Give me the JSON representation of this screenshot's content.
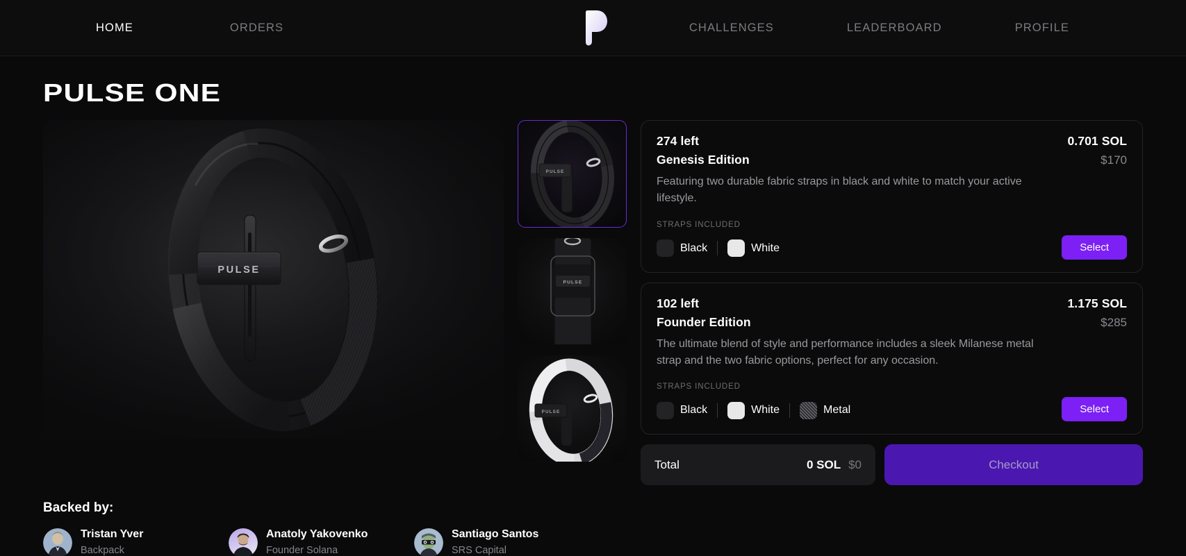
{
  "nav": {
    "left_items": [
      {
        "label": "HOME",
        "active": true
      },
      {
        "label": "ORDERS",
        "active": false
      }
    ],
    "right_items": [
      {
        "label": "CHALLENGES",
        "active": false
      },
      {
        "label": "LEADERBOARD",
        "active": false
      },
      {
        "label": "PROFILE",
        "active": false
      }
    ],
    "logo": {
      "icon": "pulse-p-logo",
      "color": "#ded9f7"
    }
  },
  "page": {
    "title_part1": "PULSE",
    "title_part2": "ONE",
    "title_full": "PULSE ONE"
  },
  "hero": {
    "alt": "Black PULSE fitness band angled view",
    "logo_text": "PULSE"
  },
  "thumbnails": [
    {
      "alt": "black band angled view",
      "logo_text": "PULSE",
      "selected": true,
      "name": "thumb-black-angled"
    },
    {
      "alt": "black band front view",
      "logo_text": "PULSE",
      "selected": false,
      "name": "thumb-black-front"
    },
    {
      "alt": "white band angled view",
      "logo_text": "PULSE",
      "selected": false,
      "name": "thumb-white-angled"
    }
  ],
  "products": [
    {
      "stock": "274 left",
      "edition": "Genesis Edition",
      "price_sol": "0.701 SOL",
      "price_usd": "$170",
      "description": "Featuring two durable fabric straps in black and white to match your active lifestyle.",
      "straps_label": "STRAPS INCLUDED",
      "straps": [
        {
          "name": "Black",
          "swatch": "black"
        },
        {
          "name": "White",
          "swatch": "white"
        }
      ],
      "select_label": "Select"
    },
    {
      "stock": "102 left",
      "edition": "Founder Edition",
      "price_sol": "1.175 SOL",
      "price_usd": "$285",
      "description": "The ultimate blend of style and performance includes a sleek Milanese metal strap and the two fabric options, perfect for any occasion.",
      "straps_label": "STRAPS INCLUDED",
      "straps": [
        {
          "name": "Black",
          "swatch": "black"
        },
        {
          "name": "White",
          "swatch": "white"
        },
        {
          "name": "Metal",
          "swatch": "metal"
        }
      ],
      "select_label": "Select"
    }
  ],
  "cart": {
    "total_label": "Total",
    "total_sol": "0 SOL",
    "total_usd": "$0",
    "checkout_label": "Checkout"
  },
  "backed_by": {
    "title": "Backed by:",
    "people": [
      {
        "name": "Tristan Yver",
        "org": "Backpack",
        "avatar": "avatar-tristan"
      },
      {
        "name": "Anatoly Yakovenko",
        "org": "Founder Solana",
        "avatar": "avatar-anatoly"
      },
      {
        "name": "Santiago Santos",
        "org": "SRS Capital",
        "avatar": "avatar-santiago"
      }
    ]
  },
  "colors": {
    "page_bg": "#0a0a0b",
    "nav_bg": "#0d0d0e",
    "accent_purple": "#7c20f5",
    "checkout_purple": "#4a18b0",
    "selected_border": "#6d28d9",
    "muted_text": "#8a8a8f"
  }
}
